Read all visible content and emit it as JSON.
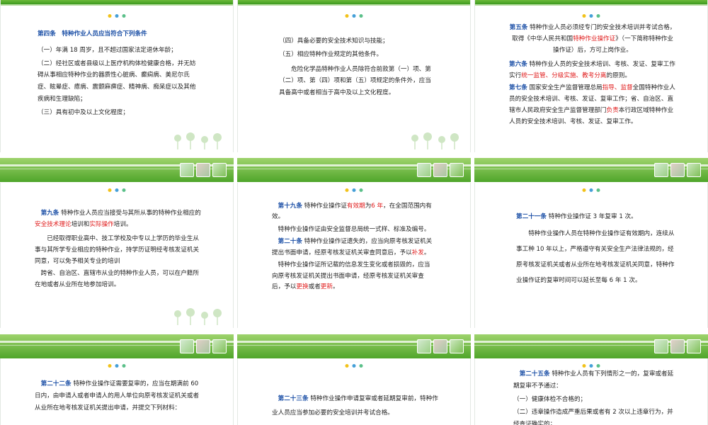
{
  "colors": {
    "article": "#1b4fa6",
    "highlight": "#e01c1c",
    "band": "#4fa52a"
  },
  "slides": {
    "s1": {
      "title": "第四条　特种作业人员应当符合下列条件",
      "l1": "（一）年满 18 周岁，且不超过国家法定退休年龄；",
      "l2": "（二）经社区或者县级以上医疗机构体检健康合格，并无妨碍从事相应特种作业的器质性心脏病、癫痫病、美尼尔氏症、眩晕症、癔病、震颤麻痹症、精神病、痴呆症以及其他疾病和生理缺陷；",
      "l3": "（三）具有初中及以上文化程度；"
    },
    "s2": {
      "l1": "（四）具备必要的安全技术知识与技能；",
      "l2": "（五）相应特种作业规定的其他条件。",
      "l3": "危险化学品特种作业人员除符合前款第（一）项、第（二）项、第（四）项和第（五）项规定的条件外，应当具备高中或者相当于高中及以上文化程度。"
    },
    "s3": {
      "a5": "第五条",
      "p1a": "特种作业人员必须经专门的安全技术培训并考试合格，取得《中华人民共和国",
      "p1b": "特种作业操作证",
      "p1c": "》（一下简称特种作业操作证）后，方可上岗作业。",
      "a6": "第六条",
      "p2a": "特种作业人员的安全技术培训、考核、发证、复审工作实行",
      "p2b": "统一监管、分级实施、教考分离",
      "p2c": "的原则。",
      "a7": "第七条",
      "p3a": "国家安全生产监督管理总局",
      "p3b": "指导、监督",
      "p3c": "全国特种作业人员的安全技术培训、考核、发证、复审工作；省、自治区、直辖市人民政府安全生产监督管理部门",
      "p3d": "负责",
      "p3e": "本行政区域特种作业人员的安全技术培训、考核、发证、复审工作。"
    },
    "s4": {
      "a9": "第九条",
      "p1a": "特种作业人员应当接受与其所从事的特种作业相应的",
      "p1b": "安全技术理论",
      "p1c": "培训和",
      "p1d": "实际操作",
      "p1e": "培训。",
      "p2": "已经取得职业高中、技工学校及中专以上学历的毕业生从事与其所学专业相应的特种作业，持学历证明经考核发证机关同意，可以免予相关专业的培训",
      "p3": "跨省、自治区、直辖市从业的特种作业人员，可以在户籍所在地或者从业所在地参加培训。"
    },
    "s5": {
      "a19": "第十九条",
      "p1a": "特种作业操作证",
      "p1b": "有效期",
      "p1c": "为",
      "p1d": "6 年",
      "p1e": "，在全国范围内有效。",
      "p2": "特种作业操作证由安全监督总局统一式样、标准及编号。",
      "a20": "第二十条",
      "p3a": "特种作业操作证遗失的，应当向原考核发证机关提出书面申请，经原考核发证机关审查同意后，予以",
      "p3b": "补发",
      "p3c": "。",
      "p4a": "特种作业操作证所记载的信息发生变化或者损毁的，应当向原考核发证机关提出书面申请，经原考核发证机关审查后，予以",
      "p4b": "更换",
      "p4c": "或者",
      "p4d": "更新",
      "p4e": "。"
    },
    "s6": {
      "a21": "第二十一条",
      "p1": "特种作业操作证 3 年复审 1 次。",
      "p2": "特种作业操作人员在特种作业操作证有效期内，连续从事工种 10 年以上，严格遵守有关安全生产法律法规的，经原考核发证机关或者从业所在地考核发证机关同意，特种作业操作证的复审时间可以延长至每 6 年 1 次。"
    },
    "s7": {
      "a22": "第二十二条",
      "p1": "特种作业操作证需要复审的，应当在期满前 60 日内，由申请人或者申请人的用人单位向原考核发证机关或者从业所在地考核发证机关提出申请，并提交下列材料："
    },
    "s8": {
      "a23": "第二十三条",
      "p1": "特种作业操作申请复审或者延期复审前，特种作业人员应当参加必要的安全培训并考试合格。"
    },
    "s9": {
      "a25": "第二十五条",
      "p1": "特种作业人员有下列情形之一的，复审或者延期复审不予通过：",
      "p2": "（一）健康体检不合格的；",
      "p3": "（二）违章操作造成严重后果或者有 2 次以上违章行为，并经查证确实的；"
    }
  }
}
